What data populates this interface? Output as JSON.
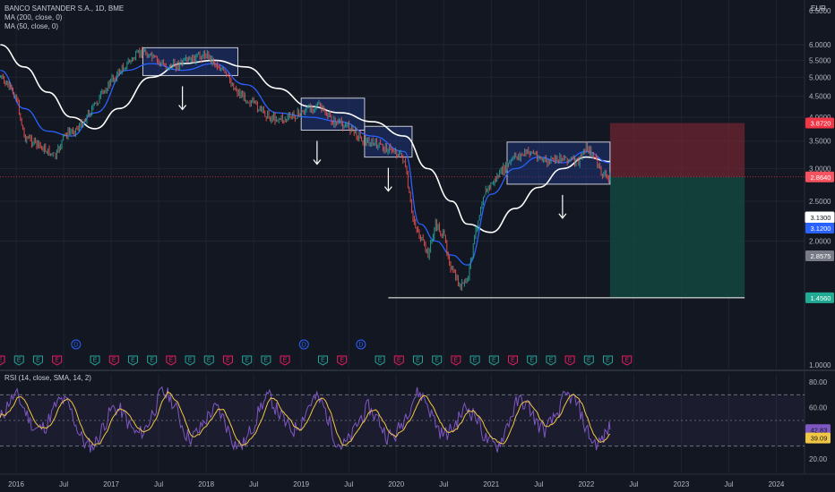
{
  "header": {
    "symbol": "BANCO SANTANDER S.A., 1D, BME",
    "ma200": "MA (200, close, 0)",
    "ma50": "MA (50, close, 0)",
    "currency": "EUR"
  },
  "rsi_legend": "RSI (14, close, SMA, 14, 2)",
  "colors": {
    "background": "#131722",
    "price": "#26a69a",
    "price_down": "#ef5350",
    "ma200": "#ffffff",
    "ma50": "#2962ff",
    "box_fill": "#1e3a8a",
    "rsi_line": "#7e57c2",
    "rsi_ma": "#f2c744",
    "stop_zone": "#6e2630",
    "target_zone": "#14463f",
    "support_line": "#ffffff",
    "dividend_marker": "#2962ff",
    "earnings_marker": "#e91e63"
  },
  "chart_data": [
    {
      "type": "line",
      "title": "BANCO SANTANDER S.A., 1D, BME",
      "x_ticks": [
        "2016",
        "Jul",
        "2017",
        "Jul",
        "2018",
        "Jul",
        "2019",
        "Jul",
        "2020",
        "Jul",
        "2021",
        "Jul",
        "2022",
        "Jul",
        "2023",
        "Jul",
        "2024"
      ],
      "y_ticks": [
        "6.5000",
        "6.0000",
        "5.5000",
        "5.0000",
        "4.5000",
        "4.0000",
        "3.5000",
        "3.0000",
        "2.5000",
        "2.0000",
        "1.0000"
      ],
      "y_scale": "log",
      "grid": true,
      "series": [
        {
          "name": "BANCO SANTANDER S.A.",
          "x": [
            "2015-11",
            "2016-01",
            "2016-02",
            "2016-04",
            "2016-06",
            "2016-07",
            "2016-09",
            "2016-11",
            "2017-01",
            "2017-03",
            "2017-05",
            "2017-06",
            "2017-08",
            "2017-10",
            "2017-12",
            "2018-01",
            "2018-03",
            "2018-05",
            "2018-07",
            "2018-09",
            "2018-11",
            "2019-01",
            "2019-03",
            "2019-05",
            "2019-07",
            "2019-09",
            "2019-11",
            "2020-01",
            "2020-02",
            "2020-03",
            "2020-04",
            "2020-05",
            "2020-06",
            "2020-07",
            "2020-08",
            "2020-09",
            "2020-10",
            "2020-11",
            "2020-12",
            "2021-02",
            "2021-04",
            "2021-06",
            "2021-08",
            "2021-10",
            "2021-12",
            "2022-01",
            "2022-02",
            "2022-03",
            "2022-04"
          ],
          "values": [
            5.0,
            4.5,
            3.6,
            3.4,
            3.2,
            3.6,
            3.8,
            4.3,
            4.9,
            5.4,
            5.8,
            5.6,
            5.3,
            5.4,
            5.6,
            5.7,
            5.2,
            4.6,
            4.3,
            4.0,
            3.95,
            4.1,
            4.3,
            3.9,
            3.8,
            3.5,
            3.4,
            3.3,
            3.15,
            2.3,
            2.05,
            1.85,
            2.2,
            2.05,
            1.7,
            1.55,
            1.6,
            2.1,
            2.6,
            2.9,
            3.2,
            3.3,
            3.1,
            3.2,
            3.1,
            3.4,
            3.2,
            2.9,
            2.86
          ]
        },
        {
          "name": "MA (200, close, 0)",
          "x": [
            "2015-11",
            "2016-02",
            "2016-05",
            "2016-08",
            "2016-11",
            "2017-02",
            "2017-06",
            "2017-10",
            "2018-02",
            "2018-06",
            "2018-10",
            "2019-02",
            "2019-06",
            "2019-10",
            "2020-02",
            "2020-05",
            "2020-08",
            "2020-10",
            "2021-01",
            "2021-04",
            "2021-07",
            "2021-10",
            "2022-01",
            "2022-04"
          ],
          "values": [
            6.0,
            5.3,
            4.6,
            4.0,
            3.75,
            4.2,
            5.0,
            5.4,
            5.5,
            5.3,
            4.7,
            4.25,
            4.1,
            3.9,
            3.6,
            3.0,
            2.5,
            2.2,
            2.1,
            2.4,
            2.7,
            3.0,
            3.2,
            3.12
          ]
        },
        {
          "name": "MA (50, close, 0)",
          "x": [
            "2015-11",
            "2016-02",
            "2016-05",
            "2016-08",
            "2016-11",
            "2017-03",
            "2017-06",
            "2017-10",
            "2018-02",
            "2018-06",
            "2018-10",
            "2019-02",
            "2019-06",
            "2019-10",
            "2020-02",
            "2020-04",
            "2020-06",
            "2020-08",
            "2020-10",
            "2021-01",
            "2021-04",
            "2021-07",
            "2021-10",
            "2022-01",
            "2022-04"
          ],
          "values": [
            5.2,
            4.2,
            3.7,
            3.6,
            4.1,
            5.2,
            5.4,
            5.2,
            5.4,
            4.8,
            4.1,
            4.0,
            3.9,
            3.6,
            3.3,
            2.2,
            2.0,
            1.85,
            1.75,
            2.6,
            3.0,
            3.2,
            3.1,
            3.3,
            3.1
          ]
        }
      ],
      "price_labels": [
        {
          "text": "3.8720",
          "value": 3.872,
          "color": "#f23645"
        },
        {
          "text": "3.1300",
          "value": 3.13,
          "color": "#ffffff"
        },
        {
          "text": "3.1200",
          "value": 3.12,
          "color": "#2962ff"
        },
        {
          "text": "2.8640",
          "value": 2.864,
          "color": "#f7525f"
        },
        {
          "text": "2.8575",
          "value": 2.8575,
          "color": "#787b86"
        },
        {
          "text": "1.4560",
          "value": 1.456,
          "color": "#22ab94"
        }
      ],
      "annotations": {
        "current_price": 2.864,
        "support_level": 1.456,
        "risk_reward": {
          "entry": 2.864,
          "stop": 3.872,
          "target": 1.456,
          "from": "2022-04",
          "to": "2023-09"
        },
        "boxes": [
          {
            "x0": "2017-05",
            "x1": "2018-05",
            "y0": 5.05,
            "y1": 5.9,
            "arrow_x": "2017-10"
          },
          {
            "x0": "2019-01",
            "x1": "2019-09",
            "y0": 3.72,
            "y1": 4.45,
            "arrow_x": "2019-03"
          },
          {
            "x0": "2019-09",
            "x1": "2020-03",
            "y0": 3.2,
            "y1": 3.8,
            "arrow_x": "2019-12"
          },
          {
            "x0": "2021-03",
            "x1": "2022-04",
            "y0": 2.75,
            "y1": 3.48,
            "arrow_x": "2021-10"
          }
        ]
      },
      "events": [
        "E",
        "E",
        "E",
        "E",
        "D",
        "E",
        "E",
        "E",
        "E",
        "E",
        "E",
        "E",
        "E",
        "E",
        "E",
        "E",
        "D",
        "E",
        "E",
        "D",
        "E",
        "E",
        "E",
        "E",
        "E",
        "E",
        "E",
        "E",
        "E",
        "E",
        "E",
        "E",
        "E",
        "E"
      ]
    },
    {
      "type": "line",
      "title": "RSI (14, close, SMA, 14, 2)",
      "y_ticks": [
        "80.00",
        "60.00",
        "40.00",
        "20.00"
      ],
      "ylim": [
        14,
        88
      ],
      "bands": [
        30,
        50,
        70
      ],
      "series": [
        {
          "name": "RSI",
          "last": 42.83,
          "label": "42.83"
        },
        {
          "name": "SMA",
          "last": 39.09,
          "label": "39.09"
        }
      ]
    }
  ]
}
